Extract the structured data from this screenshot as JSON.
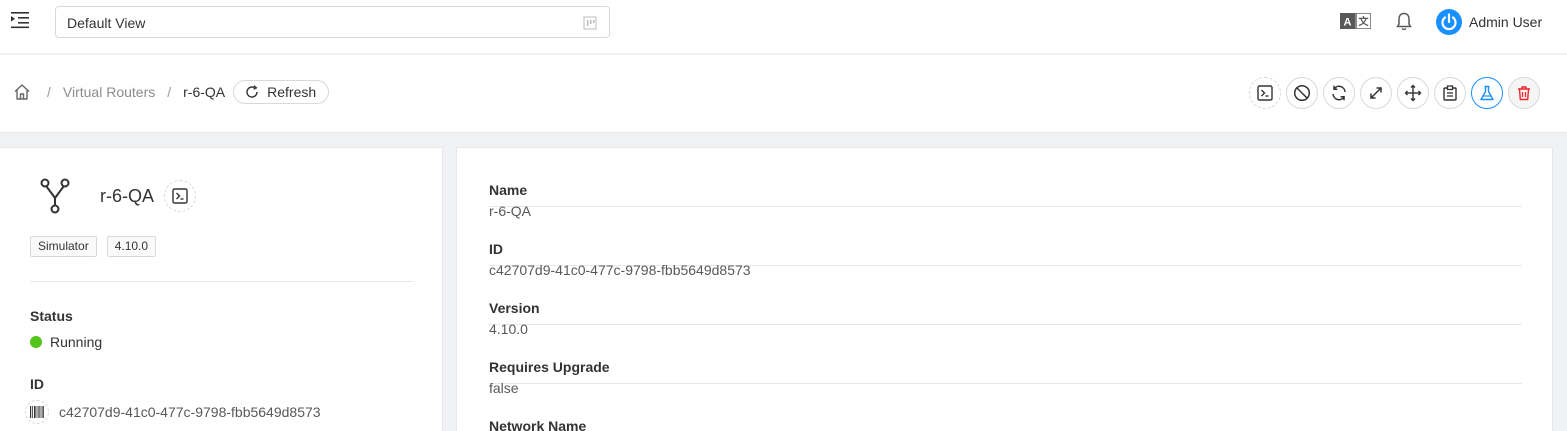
{
  "header": {
    "view_value": "Default View",
    "user_name": "Admin User",
    "icons": [
      "menu-fold-icon",
      "translate-icon",
      "bell-icon",
      "power-icon"
    ]
  },
  "breadcrumb": {
    "items": [
      "Virtual Routers",
      "r-6-QA"
    ],
    "refresh_label": "Refresh"
  },
  "actions": [
    "console-icon",
    "stop-icon",
    "reboot-icon",
    "scale-icon",
    "migrate-icon",
    "diagnostics-icon",
    "health-check-icon",
    "delete-icon"
  ],
  "summary": {
    "name": "r-6-QA",
    "tags": [
      "Simulator",
      "4.10.0"
    ],
    "status_label": "Status",
    "status_value": "Running",
    "id_label": "ID",
    "id_value": "c42707d9-41c0-477c-9798-fbb5649d8573"
  },
  "details": [
    {
      "key": "Name",
      "value": "r-6-QA"
    },
    {
      "key": "ID",
      "value": "c42707d9-41c0-477c-9798-fbb5649d8573"
    },
    {
      "key": "Version",
      "value": "4.10.0"
    },
    {
      "key": "Requires Upgrade",
      "value": "false"
    },
    {
      "key": "Network Name",
      "value": ""
    }
  ],
  "colors": {
    "primary": "#1890ff",
    "success": "#52c41a",
    "danger": "#f5222d"
  }
}
